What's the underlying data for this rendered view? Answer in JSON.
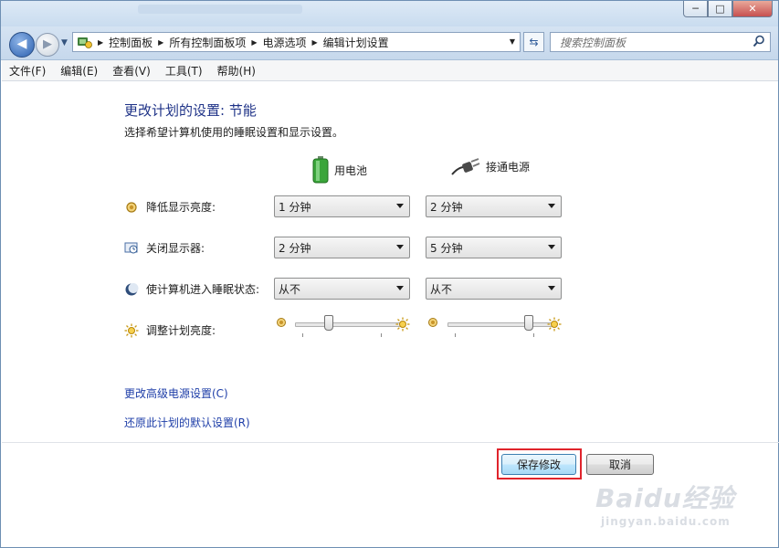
{
  "window": {
    "minimize_label": "─",
    "maximize_label": "□",
    "close_label": "✕"
  },
  "nav": {
    "back_glyph": "◀",
    "forward_glyph": "▶",
    "breadcrumb": [
      "控制面板",
      "所有控制面板项",
      "电源选项",
      "编辑计划设置"
    ],
    "search_placeholder": "搜索控制面板"
  },
  "menu": [
    "文件(F)",
    "编辑(E)",
    "查看(V)",
    "工具(T)",
    "帮助(H)"
  ],
  "page": {
    "title": "更改计划的设置: 节能",
    "subtitle": "选择希望计算机使用的睡眠设置和显示设置。",
    "col_battery": "用电池",
    "col_plugged": "接通电源"
  },
  "rows": [
    {
      "label": "降低显示亮度:",
      "battery": "1 分钟",
      "plugged": "2 分钟"
    },
    {
      "label": "关闭显示器:",
      "battery": "2 分钟",
      "plugged": "5 分钟"
    },
    {
      "label": "使计算机进入睡眠状态:",
      "battery": "从不",
      "plugged": "从不"
    }
  ],
  "brightness": {
    "label": "调整计划亮度:",
    "battery_level": 0.3,
    "plugged_level": 0.78
  },
  "links": {
    "advanced": "更改高级电源设置(C)",
    "restore": "还原此计划的默认设置(R)"
  },
  "buttons": {
    "save": "保存修改",
    "cancel": "取消"
  },
  "watermark": {
    "logo": "Baidu经验",
    "url": "jingyan.baidu.com"
  },
  "colors": {
    "title": "#1e3287",
    "link": "#1e3ea8",
    "highlight": "#e0242c"
  },
  "icons": [
    "control-panel-icon",
    "battery-icon",
    "power-plug-icon",
    "dim-display-icon",
    "display-off-icon",
    "sleep-icon",
    "brightness-icon",
    "search-icon",
    "refresh-icon"
  ]
}
